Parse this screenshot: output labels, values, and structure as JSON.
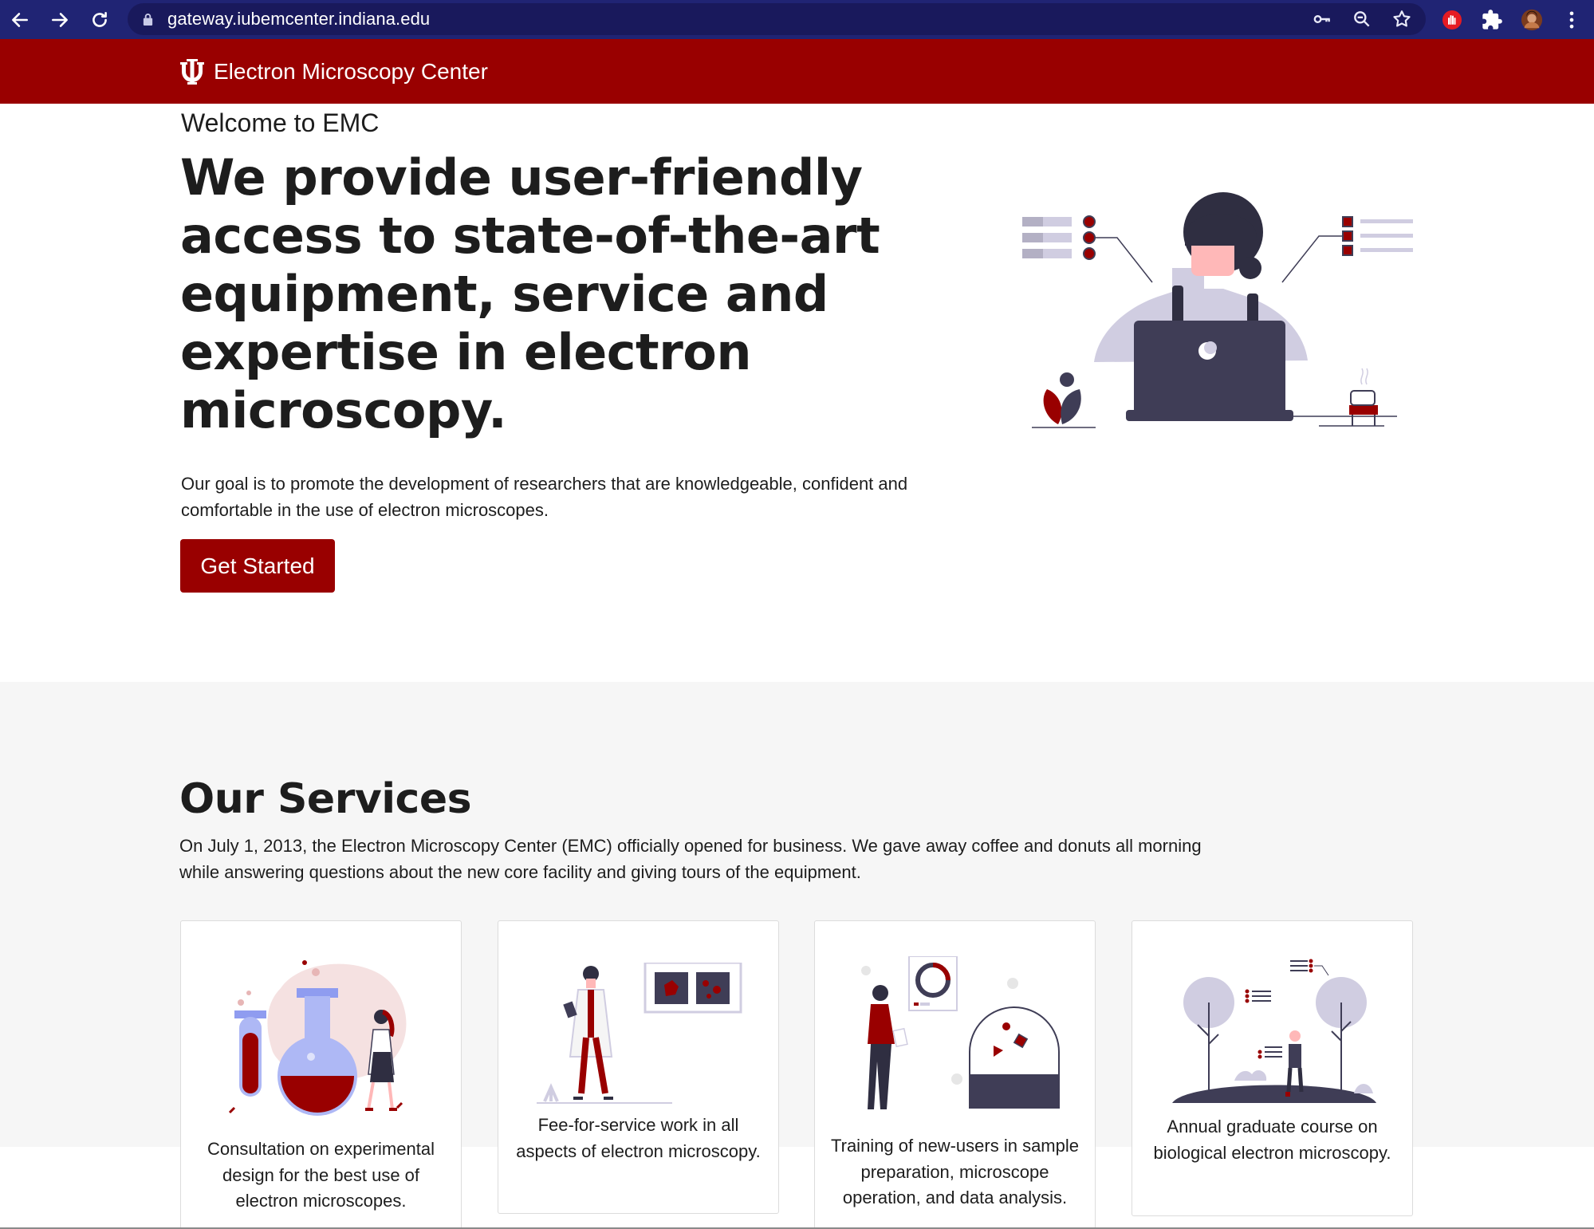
{
  "browser": {
    "url": "gateway.iubemcenter.indiana.edu"
  },
  "header": {
    "brand": "Electron Microscopy Center"
  },
  "hero": {
    "kicker": "Welcome to EMC",
    "title": "We provide user-friendly access to state-of-the-art equipment, service and expertise in electron microscopy.",
    "description": "Our goal is to promote the development of researchers that are knowledgeable, confident and comfortable in the use of electron microscopes.",
    "cta_label": "Get Started"
  },
  "services": {
    "title": "Our Services",
    "description": "On July 1, 2013, the Electron Microscopy Center (EMC) officially opened for business. We gave away coffee and donuts all morning while answering questions about the new core facility and giving tours of the equipment.",
    "cards": [
      {
        "text": "Consultation on experimental design for the best use of electron microscopes."
      },
      {
        "text": "Fee-for-service work in all aspects of electron microscopy."
      },
      {
        "text": "Training of new-users in sample preparation, microscope operation, and data analysis."
      },
      {
        "text": "Annual graduate course on biological electron microscopy."
      }
    ]
  },
  "colors": {
    "brand_red": "#990000",
    "browser_bar": "#202474",
    "illustration_dark": "#3f3d56",
    "illustration_light": "#d0cde1"
  }
}
